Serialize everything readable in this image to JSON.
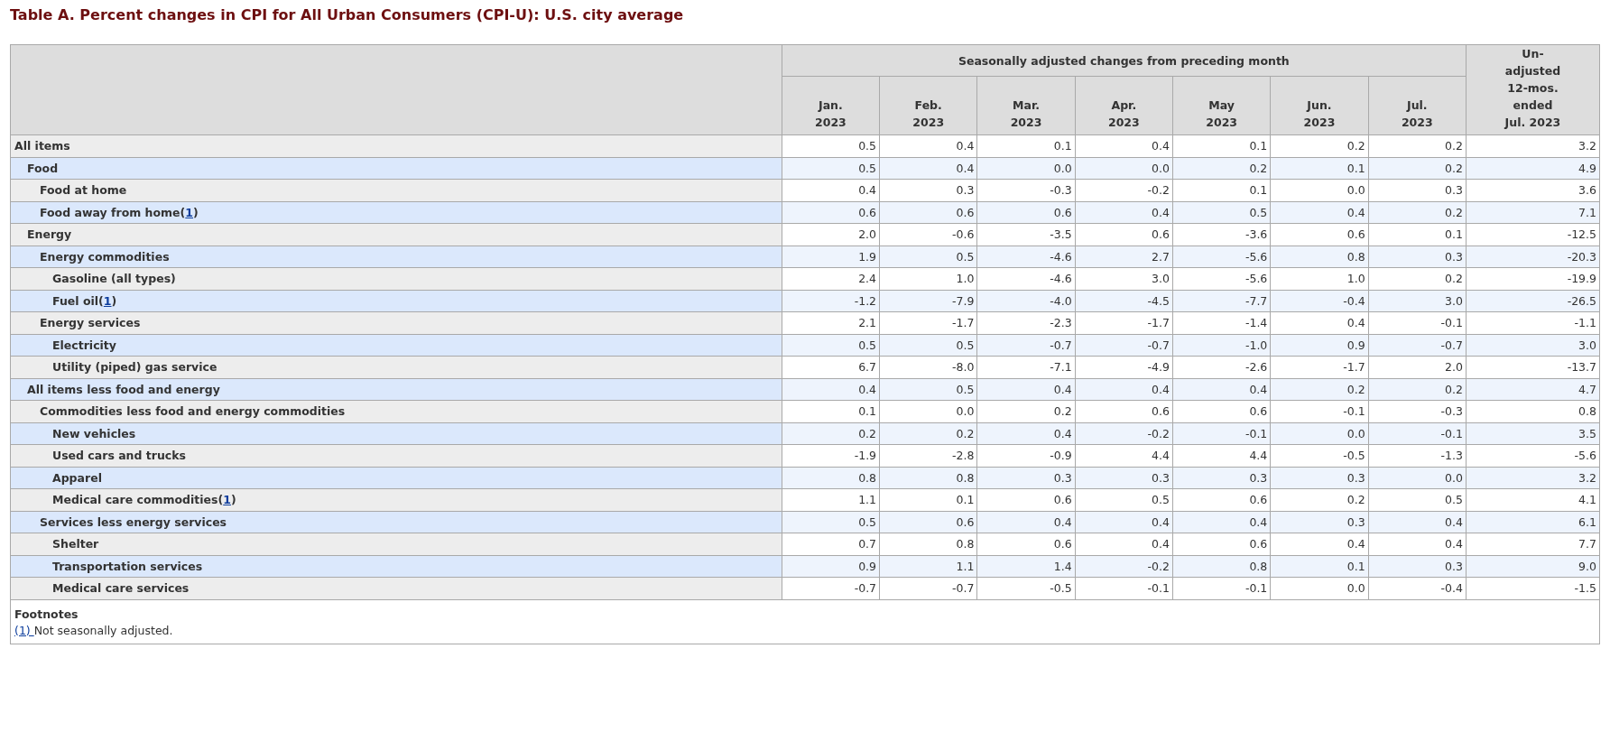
{
  "title": "Table A. Percent changes in CPI for All Urban Consumers (CPI-U): U.S. city average",
  "table": {
    "group_heading": "Seasonally adjusted changes from preceding month",
    "columns": [
      [
        "Jan.",
        "2023"
      ],
      [
        "Feb.",
        "2023"
      ],
      [
        "Mar.",
        "2023"
      ],
      [
        "Apr.",
        "2023"
      ],
      [
        "May",
        "2023"
      ],
      [
        "Jun.",
        "2023"
      ],
      [
        "Jul.",
        "2023"
      ]
    ],
    "last_column": [
      "Un-",
      "adjusted",
      "12-mos.",
      "ended",
      "Jul. 2023"
    ],
    "rows": [
      {
        "label": "All items",
        "values": [
          "0.5",
          "0.4",
          "0.1",
          "0.4",
          "0.1",
          "0.2",
          "0.2",
          "3.2"
        ],
        "children": [
          {
            "label": "Food",
            "values": [
              "0.5",
              "0.4",
              "0.0",
              "0.0",
              "0.2",
              "0.1",
              "0.2",
              "4.9"
            ],
            "children": [
              {
                "label": "Food at home",
                "values": [
                  "0.4",
                  "0.3",
                  "-0.3",
                  "-0.2",
                  "0.1",
                  "0.0",
                  "0.3",
                  "3.6"
                ]
              },
              {
                "label": "Food away from home",
                "footnote": {
                  "before": "(",
                  "mark": "1",
                  "after": ")"
                },
                "values": [
                  "0.6",
                  "0.6",
                  "0.6",
                  "0.4",
                  "0.5",
                  "0.4",
                  "0.2",
                  "7.1"
                ]
              }
            ]
          },
          {
            "label": "Energy",
            "values": [
              "2.0",
              "-0.6",
              "-3.5",
              "0.6",
              "-3.6",
              "0.6",
              "0.1",
              "-12.5"
            ],
            "children": [
              {
                "label": "Energy commodities",
                "values": [
                  "1.9",
                  "0.5",
                  "-4.6",
                  "2.7",
                  "-5.6",
                  "0.8",
                  "0.3",
                  "-20.3"
                ],
                "children": [
                  {
                    "label": "Gasoline (all types)",
                    "values": [
                      "2.4",
                      "1.0",
                      "-4.6",
                      "3.0",
                      "-5.6",
                      "1.0",
                      "0.2",
                      "-19.9"
                    ]
                  },
                  {
                    "label": "Fuel oil",
                    "footnote": {
                      "before": "(",
                      "mark": "1",
                      "after": ")"
                    },
                    "values": [
                      "-1.2",
                      "-7.9",
                      "-4.0",
                      "-4.5",
                      "-7.7",
                      "-0.4",
                      "3.0",
                      "-26.5"
                    ]
                  }
                ]
              },
              {
                "label": "Energy services",
                "values": [
                  "2.1",
                  "-1.7",
                  "-2.3",
                  "-1.7",
                  "-1.4",
                  "0.4",
                  "-0.1",
                  "-1.1"
                ],
                "children": [
                  {
                    "label": "Electricity",
                    "values": [
                      "0.5",
                      "0.5",
                      "-0.7",
                      "-0.7",
                      "-1.0",
                      "0.9",
                      "-0.7",
                      "3.0"
                    ]
                  },
                  {
                    "label": "Utility (piped) gas service",
                    "values": [
                      "6.7",
                      "-8.0",
                      "-7.1",
                      "-4.9",
                      "-2.6",
                      "-1.7",
                      "2.0",
                      "-13.7"
                    ]
                  }
                ]
              }
            ]
          },
          {
            "label": "All items less food and energy",
            "values": [
              "0.4",
              "0.5",
              "0.4",
              "0.4",
              "0.4",
              "0.2",
              "0.2",
              "4.7"
            ],
            "children": [
              {
                "label": "Commodities less food and energy commodities",
                "values": [
                  "0.1",
                  "0.0",
                  "0.2",
                  "0.6",
                  "0.6",
                  "-0.1",
                  "-0.3",
                  "0.8"
                ],
                "children": [
                  {
                    "label": "New vehicles",
                    "values": [
                      "0.2",
                      "0.2",
                      "0.4",
                      "-0.2",
                      "-0.1",
                      "0.0",
                      "-0.1",
                      "3.5"
                    ]
                  },
                  {
                    "label": "Used cars and trucks",
                    "values": [
                      "-1.9",
                      "-2.8",
                      "-0.9",
                      "4.4",
                      "4.4",
                      "-0.5",
                      "-1.3",
                      "-5.6"
                    ]
                  },
                  {
                    "label": "Apparel",
                    "values": [
                      "0.8",
                      "0.8",
                      "0.3",
                      "0.3",
                      "0.3",
                      "0.3",
                      "0.0",
                      "3.2"
                    ]
                  },
                  {
                    "label": "Medical care commodities",
                    "footnote": {
                      "before": "(",
                      "mark": "1",
                      "after": ")"
                    },
                    "values": [
                      "1.1",
                      "0.1",
                      "0.6",
                      "0.5",
                      "0.6",
                      "0.2",
                      "0.5",
                      "4.1"
                    ]
                  }
                ]
              },
              {
                "label": "Services less energy services",
                "values": [
                  "0.5",
                  "0.6",
                  "0.4",
                  "0.4",
                  "0.4",
                  "0.3",
                  "0.4",
                  "6.1"
                ],
                "children": [
                  {
                    "label": "Shelter",
                    "values": [
                      "0.7",
                      "0.8",
                      "0.6",
                      "0.4",
                      "0.6",
                      "0.4",
                      "0.4",
                      "7.7"
                    ]
                  },
                  {
                    "label": "Transportation services",
                    "values": [
                      "0.9",
                      "1.1",
                      "1.4",
                      "-0.2",
                      "0.8",
                      "0.1",
                      "0.3",
                      "9.0"
                    ]
                  },
                  {
                    "label": "Medical care services",
                    "values": [
                      "-0.7",
                      "-0.7",
                      "-0.5",
                      "-0.1",
                      "-0.1",
                      "0.0",
                      "-0.4",
                      "-1.5"
                    ]
                  }
                ]
              }
            ]
          }
        ]
      }
    ]
  },
  "footnotes": {
    "heading": "Footnotes",
    "items": [
      {
        "mark": "(1)",
        "text": "Not seasonally adjusted."
      }
    ]
  }
}
